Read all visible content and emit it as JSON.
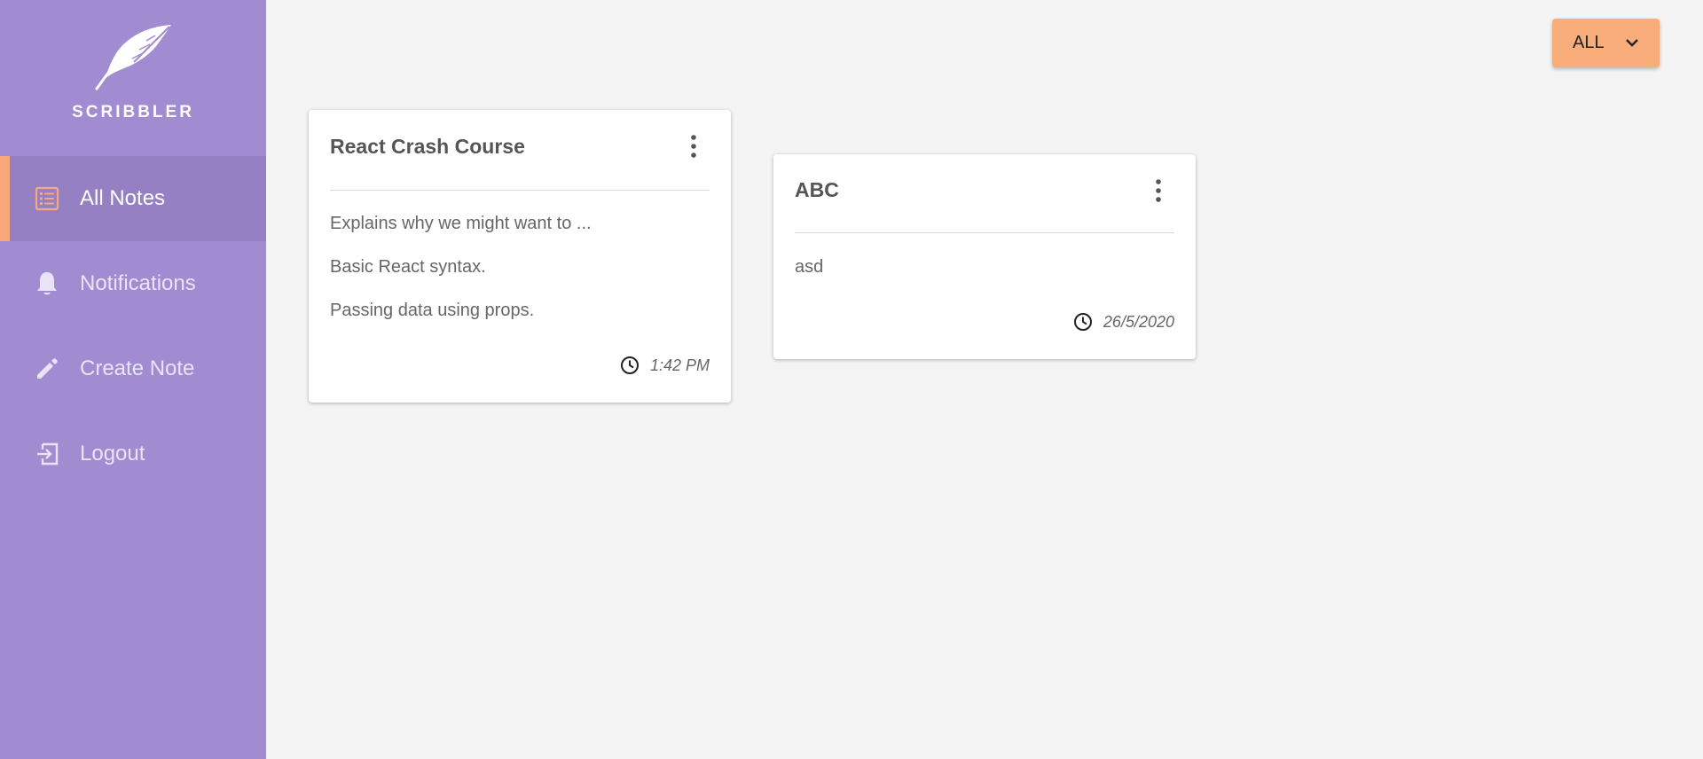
{
  "brand": {
    "name": "SCRIBBLER",
    "logo_icon": "feather-quill-icon"
  },
  "sidebar": {
    "items": [
      {
        "label": "All Notes",
        "icon": "list-icon",
        "active": true
      },
      {
        "label": "Notifications",
        "icon": "bell-icon",
        "active": false
      },
      {
        "label": "Create Note",
        "icon": "pencil-icon",
        "active": false
      },
      {
        "label": "Logout",
        "icon": "logout-icon",
        "active": false
      }
    ]
  },
  "filter": {
    "label": "ALL",
    "icon": "chevron-down-icon"
  },
  "notes": [
    {
      "title": "React Crash Course",
      "lines": [
        "Explains why we might want to ...",
        "Basic React syntax.",
        "Passing data using props."
      ],
      "time": "1:42 PM"
    },
    {
      "title": "ABC",
      "lines": [
        "asd"
      ],
      "time": "26/5/2020"
    }
  ],
  "colors": {
    "sidebar": "#a18cd1",
    "sidebar_active": "#9580c4",
    "accent": "#f8a97c",
    "background": "#f4f4f4"
  }
}
